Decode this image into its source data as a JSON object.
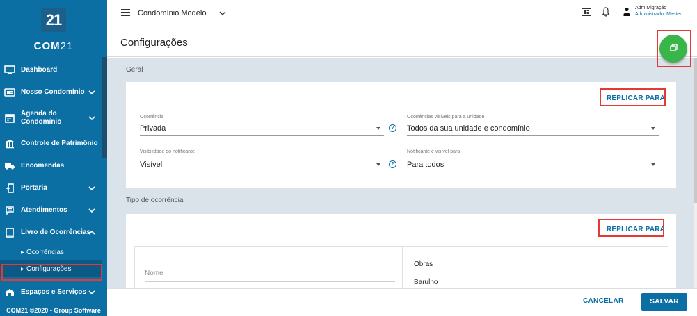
{
  "sidebar": {
    "logo_badge": "21",
    "logo_bold": "COM",
    "logo_light": "21",
    "items": [
      {
        "label": "Dashboard",
        "icon": "monitor-icon"
      },
      {
        "label": "Nosso Condomínio",
        "icon": "card-icon"
      },
      {
        "label_line1": "Agenda do",
        "label_line2": "Condomínio",
        "icon": "calendar-icon"
      },
      {
        "label": "Controle de Patrimônio",
        "icon": "bank-icon"
      },
      {
        "label": "Encomendas",
        "icon": "truck-icon"
      },
      {
        "label": "Portaria",
        "icon": "door-icon"
      },
      {
        "label": "Atendimentos",
        "icon": "chat-icon"
      },
      {
        "label": "Livro de Ocorrências",
        "icon": "book-icon"
      },
      {
        "label": "Espaços e Serviços",
        "icon": "space-icon"
      }
    ],
    "sub_items": [
      {
        "label": "Ocorrências"
      },
      {
        "label": "Configurações"
      }
    ],
    "footer": "COM21 ©2020 - Group Software"
  },
  "topbar": {
    "condo_name": "Condomínio Modelo",
    "user_name": "Adm Migração",
    "user_role": "Administrador Master"
  },
  "page": {
    "title": "Configurações"
  },
  "geral": {
    "section_title": "Geral",
    "replicar_label": "REPLICAR PARA",
    "fields": {
      "ocorrencia_label": "Ocorrência",
      "ocorrencia_value": "Privada",
      "visiveis_label": "Ocorrências visíveis para a unidade",
      "visiveis_value": "Todos da sua unidade e condomínio",
      "visibilidade_label": "Visibilidade do notificante",
      "visibilidade_value": "Visível",
      "notificante_label": "Notificante é visível para",
      "notificante_value": "Para todos"
    }
  },
  "tipo": {
    "section_title": "Tipo de ocorrência",
    "replicar_label": "REPLICAR PARA",
    "nome_placeholder": "Nome",
    "list": [
      "Obras",
      "Barulho"
    ]
  },
  "actions": {
    "cancel": "CANCELAR",
    "save": "SALVAR"
  },
  "colors": {
    "primary": "#0b6fa3",
    "fab": "#3ab54a",
    "highlight": "#e53935"
  }
}
